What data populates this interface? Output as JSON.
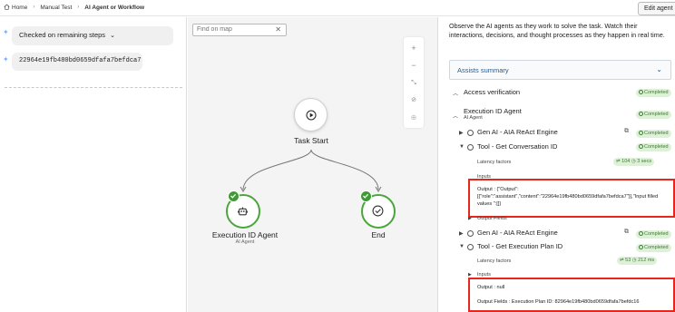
{
  "breadcrumb": {
    "home": "Home",
    "level2": "Manual Test",
    "current": "AI Agent or Workflow"
  },
  "toolbar": {
    "edit_label": "Edit agent"
  },
  "left": {
    "step_chip": "Checked on remaining steps",
    "id_chip": "22964e19fb480bd0659dfafa7befdca7"
  },
  "canvas": {
    "find_placeholder": "Find on map",
    "start_label": "Task Start",
    "agent_label": "Execution ID Agent",
    "agent_sub": "AI Agent",
    "end_label": "End"
  },
  "right": {
    "intro": "Observe the AI agents as they work to solve the task. Watch their interactions, decisions, and thought processes as they happen in real time.",
    "assists_summary": "Assists summary",
    "completed": "Completed",
    "access_verification": "Access verification",
    "execution_agent": "Execution ID Agent",
    "execution_agent_sub": "AI Agent",
    "genai_1": "Gen AI - AIA ReAct Engine",
    "tool_conv": "Tool - Get Conversation ID",
    "latency_1": "Latency factors",
    "latency_1_tokens": "104",
    "latency_1_time": "3 secs",
    "inputs_1": "Inputs",
    "output_1_line1": "Output : {\"Output\":",
    "output_1_line2": "[{\"role\":\"assistant\",\"content\":\"22964e19fb480bd0659dfafa7befdca7\"}],\"Input filled",
    "output_1_line3": "values \":[]}",
    "output_fields_1": "Output Fields",
    "genai_2": "Gen AI - AIA ReAct Engine",
    "tool_exec": "Tool - Get Execution Plan ID",
    "latency_2": "Latency factors",
    "latency_2_tokens": "53",
    "latency_2_time": "212 ms",
    "inputs_2": "Inputs",
    "output_2": "Output : null",
    "output_fields_2": "Output Fields : Execution Plan ID: 82964e19fb480bd0659dfafa7befdc16"
  },
  "colors": {
    "success": "#3d9a34",
    "highlight": "#e8271c",
    "link": "#2a5c8a"
  }
}
